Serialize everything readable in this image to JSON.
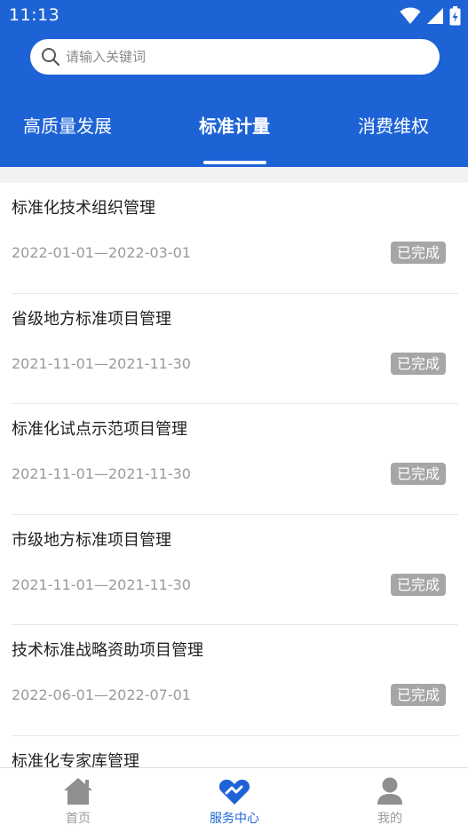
{
  "status_bar": {
    "time": "11:13"
  },
  "search": {
    "placeholder": "请输入关键词"
  },
  "tabs": [
    {
      "label": "高质量发展",
      "active": false
    },
    {
      "label": "标准计量",
      "active": true
    },
    {
      "label": "消费维权",
      "active": false
    }
  ],
  "items": [
    {
      "title": "标准化技术组织管理",
      "date": "2022-01-01—2022-03-01",
      "status": "已完成"
    },
    {
      "title": "省级地方标准项目管理",
      "date": "2021-11-01—2021-11-30",
      "status": "已完成"
    },
    {
      "title": "标准化试点示范项目管理",
      "date": "2021-11-01—2021-11-30",
      "status": "已完成"
    },
    {
      "title": "市级地方标准项目管理",
      "date": "2021-11-01—2021-11-30",
      "status": "已完成"
    },
    {
      "title": "技术标准战略资助项目管理",
      "date": "2022-06-01—2022-07-01",
      "status": "已完成"
    },
    {
      "title": "标准化专家库管理",
      "date": "",
      "status": ""
    }
  ],
  "bottom_nav": [
    {
      "label": "首页",
      "icon": "home-icon",
      "active": false
    },
    {
      "label": "服务中心",
      "icon": "service-center-icon",
      "active": true
    },
    {
      "label": "我的",
      "icon": "profile-icon",
      "active": false
    }
  ],
  "colors": {
    "primary": "#1d63d6",
    "badge_bg": "#a6a6a6",
    "inactive": "#9a9a9a"
  }
}
